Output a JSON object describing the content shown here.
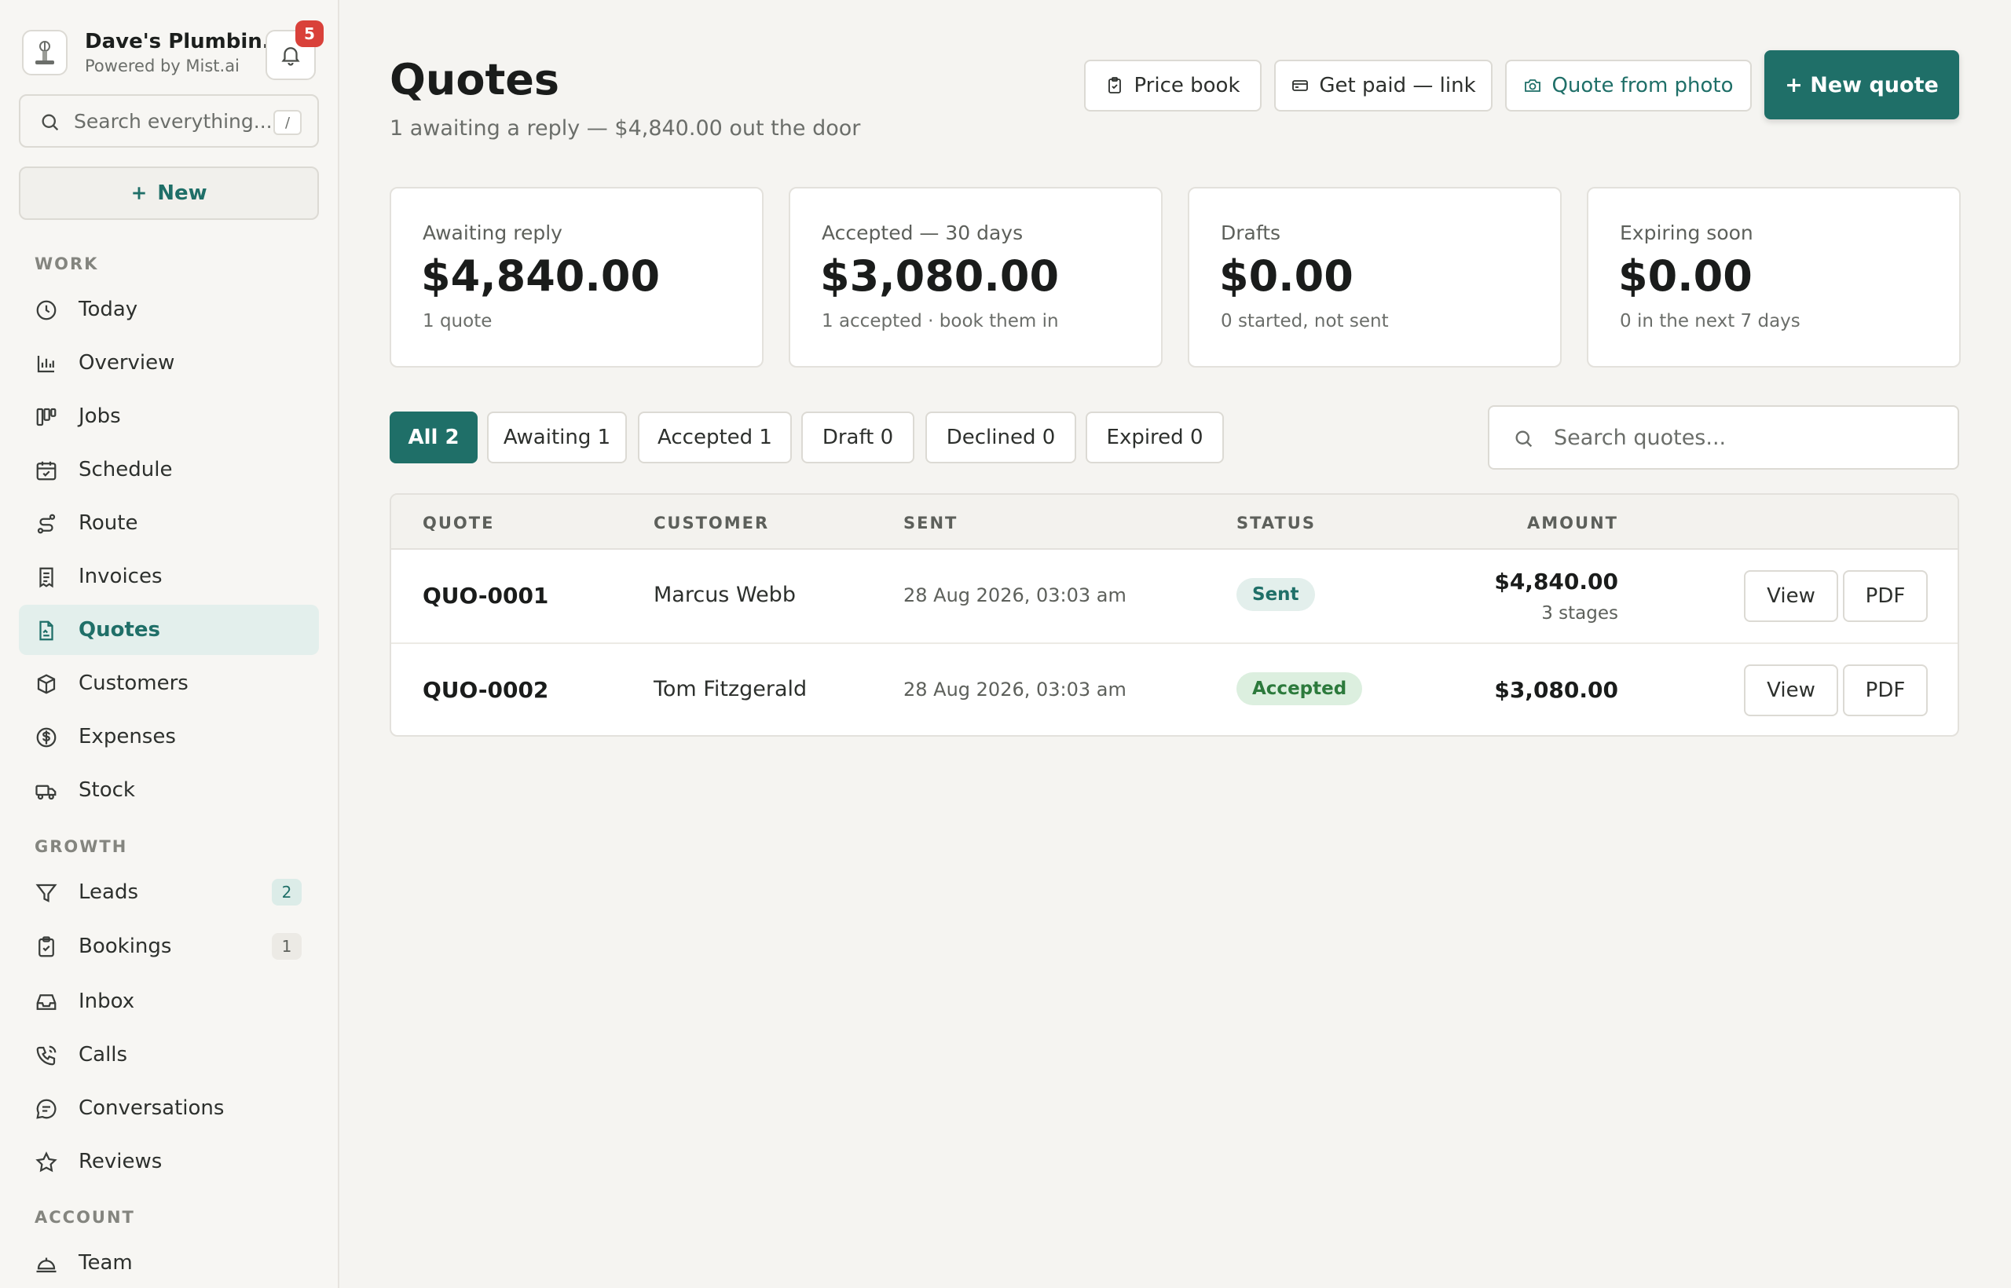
{
  "sidebar": {
    "brand_name": "Dave's Plumbin...",
    "brand_sub": "Powered by Mist.ai",
    "notifications": "5",
    "search_placeholder": "Search everything...",
    "search_shortcut": "/",
    "new_label": "New",
    "sections": {
      "work": "WORK",
      "growth": "GROWTH",
      "account": "ACCOUNT"
    },
    "items": [
      {
        "label": "Today",
        "icon": "clock-icon"
      },
      {
        "label": "Overview",
        "icon": "bar-chart-icon"
      },
      {
        "label": "Jobs",
        "icon": "kanban-icon"
      },
      {
        "label": "Schedule",
        "icon": "calendar-icon"
      },
      {
        "label": "Route",
        "icon": "route-icon"
      },
      {
        "label": "Invoices",
        "icon": "receipt-icon"
      },
      {
        "label": "Quotes",
        "icon": "document-icon"
      },
      {
        "label": "Customers",
        "icon": "box-icon"
      },
      {
        "label": "Expenses",
        "icon": "dollar-circle-icon"
      },
      {
        "label": "Stock",
        "icon": "truck-icon"
      },
      {
        "label": "Leads",
        "icon": "filter-icon",
        "count": "2"
      },
      {
        "label": "Bookings",
        "icon": "clipboard-check-icon",
        "count": "1"
      },
      {
        "label": "Inbox",
        "icon": "inbox-icon"
      },
      {
        "label": "Calls",
        "icon": "phone-icon"
      },
      {
        "label": "Conversations",
        "icon": "chat-bubble-icon"
      },
      {
        "label": "Reviews",
        "icon": "star-icon"
      },
      {
        "label": "Team",
        "icon": "bell-service-icon"
      }
    ]
  },
  "header": {
    "title": "Quotes",
    "subtitle": "1 awaiting a reply — $4,840.00 out the door",
    "price_book": "Price book",
    "get_paid": "Get paid — link",
    "quote_from_photo": "Quote from photo",
    "new_quote": "+ New quote"
  },
  "stats": [
    {
      "label": "Awaiting reply",
      "value": "$4,840.00",
      "sub": "1 quote"
    },
    {
      "label": "Accepted — 30 days",
      "value": "$3,080.00",
      "sub": "1 accepted · book them in"
    },
    {
      "label": "Drafts",
      "value": "$0.00",
      "sub": "0 started, not sent"
    },
    {
      "label": "Expiring soon",
      "value": "$0.00",
      "sub": "0 in the next 7 days"
    }
  ],
  "filters": [
    "All 2",
    "Awaiting 1",
    "Accepted 1",
    "Draft 0",
    "Declined 0",
    "Expired 0"
  ],
  "quote_search_placeholder": "Search quotes...",
  "table": {
    "columns": [
      "QUOTE",
      "CUSTOMER",
      "SENT",
      "STATUS",
      "AMOUNT"
    ],
    "rows": [
      {
        "id": "QUO-0001",
        "customer": "Marcus Webb",
        "sent": "28 Aug 2026, 03:03 am",
        "status": "Sent",
        "amount": "$4,840.00",
        "amount_sub": "3 stages",
        "view": "View",
        "pdf": "PDF"
      },
      {
        "id": "QUO-0002",
        "customer": "Tom Fitzgerald",
        "sent": "28 Aug 2026, 03:03 am",
        "status": "Accepted",
        "amount": "$3,080.00",
        "view": "View",
        "pdf": "PDF"
      }
    ]
  },
  "colors": {
    "accent": "#1f6f68",
    "badge_red": "#d9413a",
    "accepted_green": "#2c7a3c"
  }
}
